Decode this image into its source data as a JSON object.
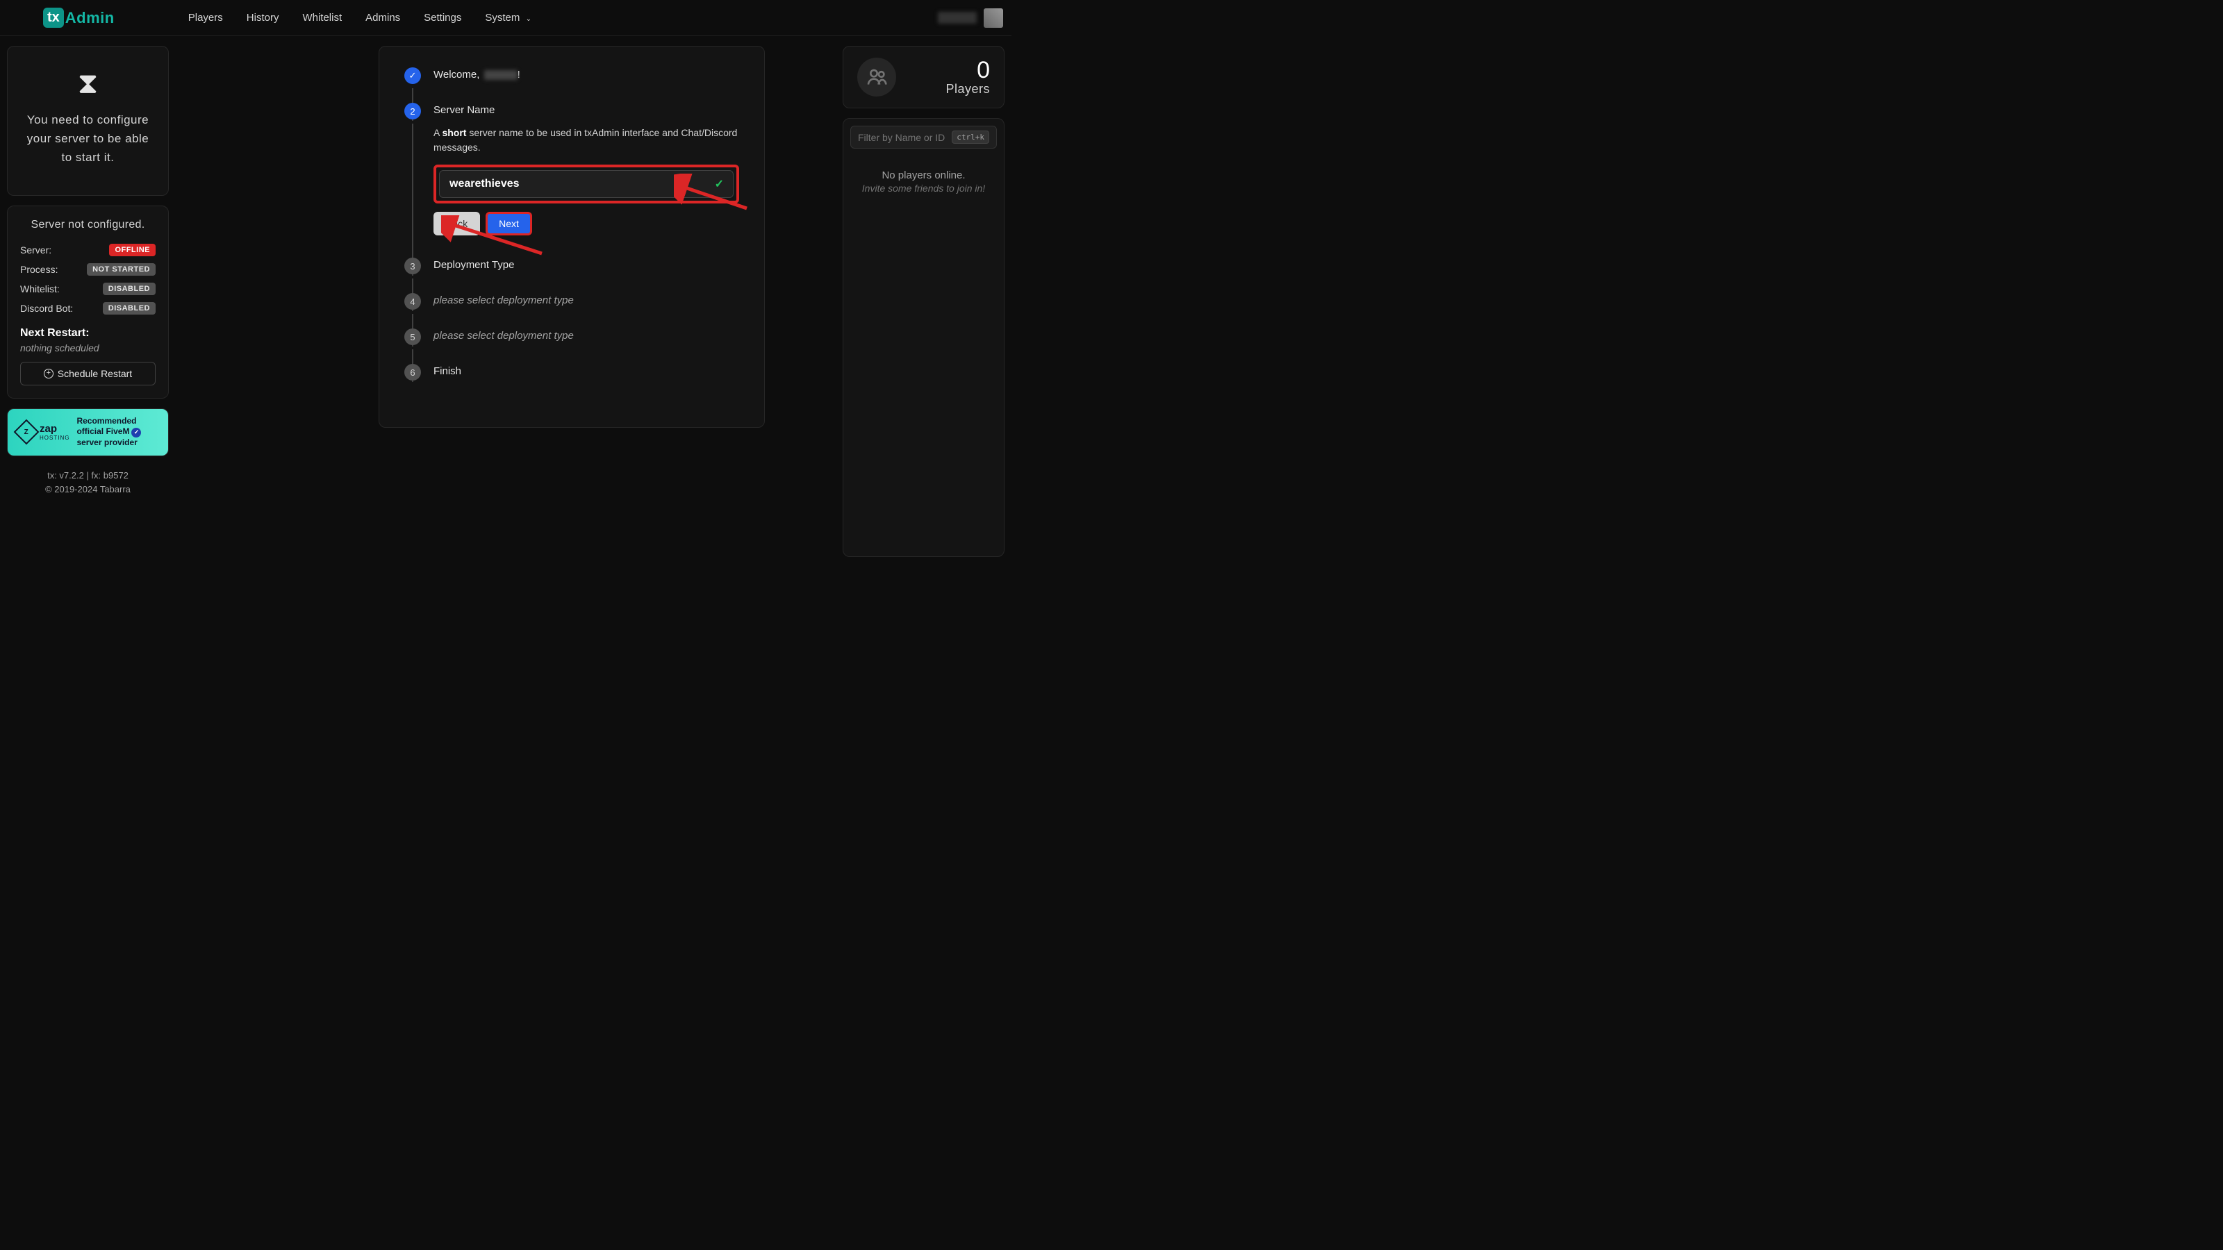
{
  "header": {
    "logo_tx": "tx",
    "logo_admin": "Admin",
    "nav": [
      "Players",
      "History",
      "Whitelist",
      "Admins",
      "Settings",
      "System"
    ]
  },
  "left": {
    "config_msg": "You need to configure your server to be able to start it.",
    "status_title": "Server not configured.",
    "rows": {
      "server": {
        "label": "Server:",
        "value": "OFFLINE"
      },
      "process": {
        "label": "Process:",
        "value": "NOT STARTED"
      },
      "whitelist": {
        "label": "Whitelist:",
        "value": "DISABLED"
      },
      "discord": {
        "label": "Discord Bot:",
        "value": "DISABLED"
      }
    },
    "next_restart": "Next Restart:",
    "nothing": "nothing scheduled",
    "schedule_btn": "Schedule Restart",
    "zap_name": "zap",
    "zap_sub": "HOSTING",
    "zap_desc1": "Recommended",
    "zap_desc2": "official FiveM",
    "zap_desc3": "server provider",
    "footer1": "tx: v7.2.2 | fx: b9572",
    "footer2": "© 2019-2024 Tabarra"
  },
  "wizard": {
    "step1": {
      "welcome": "Welcome, "
    },
    "step2": {
      "title": "Server Name",
      "desc_a": "A ",
      "desc_b": "short",
      "desc_c": " server name to be used in txAdmin interface and Chat/Discord messages.",
      "value": "wearethieves",
      "back": "Back",
      "next": "Next"
    },
    "step3": {
      "title": "Deployment Type"
    },
    "step4": {
      "title": "please select deployment type"
    },
    "step5": {
      "title": "please select deployment type"
    },
    "step6": {
      "title": "Finish"
    }
  },
  "right": {
    "count": "0",
    "label": "Players",
    "filter_placeholder": "Filter by Name or ID",
    "kbd": "ctrl+k",
    "empty1": "No players online.",
    "empty2": "Invite some friends to join in!"
  }
}
